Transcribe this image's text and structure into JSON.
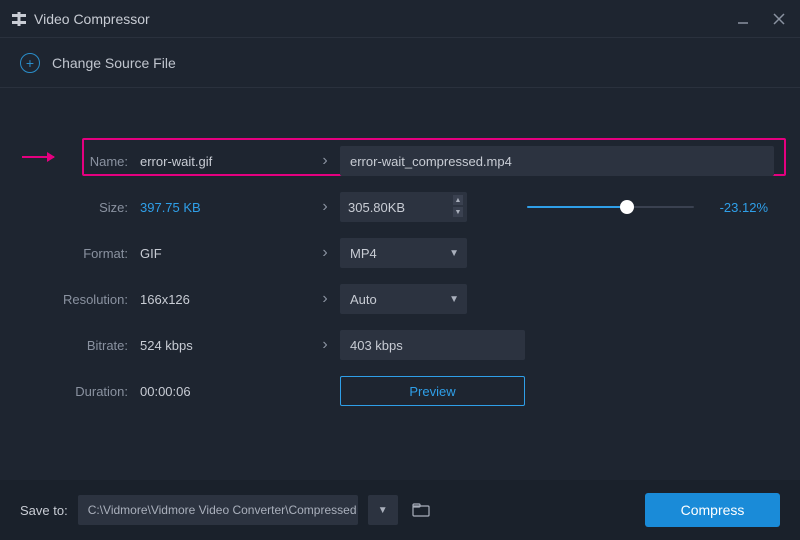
{
  "window": {
    "title": "Video Compressor"
  },
  "sourcebar": {
    "label": "Change Source File"
  },
  "rows": {
    "name": {
      "label": "Name:",
      "value": "error-wait.gif",
      "output": "error-wait_compressed.mp4"
    },
    "size": {
      "label": "Size:",
      "value": "397.75 KB",
      "output": "305.80KB",
      "percent": "-23.12%",
      "slider_percent": 60
    },
    "format": {
      "label": "Format:",
      "value": "GIF",
      "output": "MP4"
    },
    "resolution": {
      "label": "Resolution:",
      "value": "166x126",
      "output": "Auto"
    },
    "bitrate": {
      "label": "Bitrate:",
      "value": "524 kbps",
      "output": "403 kbps"
    },
    "duration": {
      "label": "Duration:",
      "value": "00:00:06"
    }
  },
  "preview": {
    "label": "Preview"
  },
  "footer": {
    "save_label": "Save to:",
    "path": "C:\\Vidmore\\Vidmore Video Converter\\Compressed",
    "compress": "Compress"
  }
}
